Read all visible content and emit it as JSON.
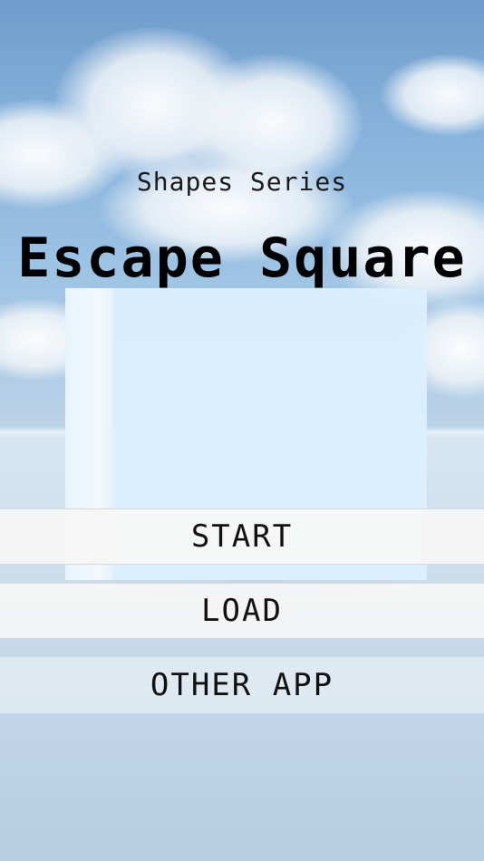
{
  "header": {
    "series_label": "Shapes Series",
    "game_title": "Escape Square"
  },
  "menu": {
    "start_label": "START",
    "load_label": "LOAD",
    "other_app_label": "OTHER APP"
  },
  "colors": {
    "sky": "#86b2dc",
    "cube": "#dcefff",
    "button_bg": "#f6f6f6",
    "text": "#000000"
  }
}
